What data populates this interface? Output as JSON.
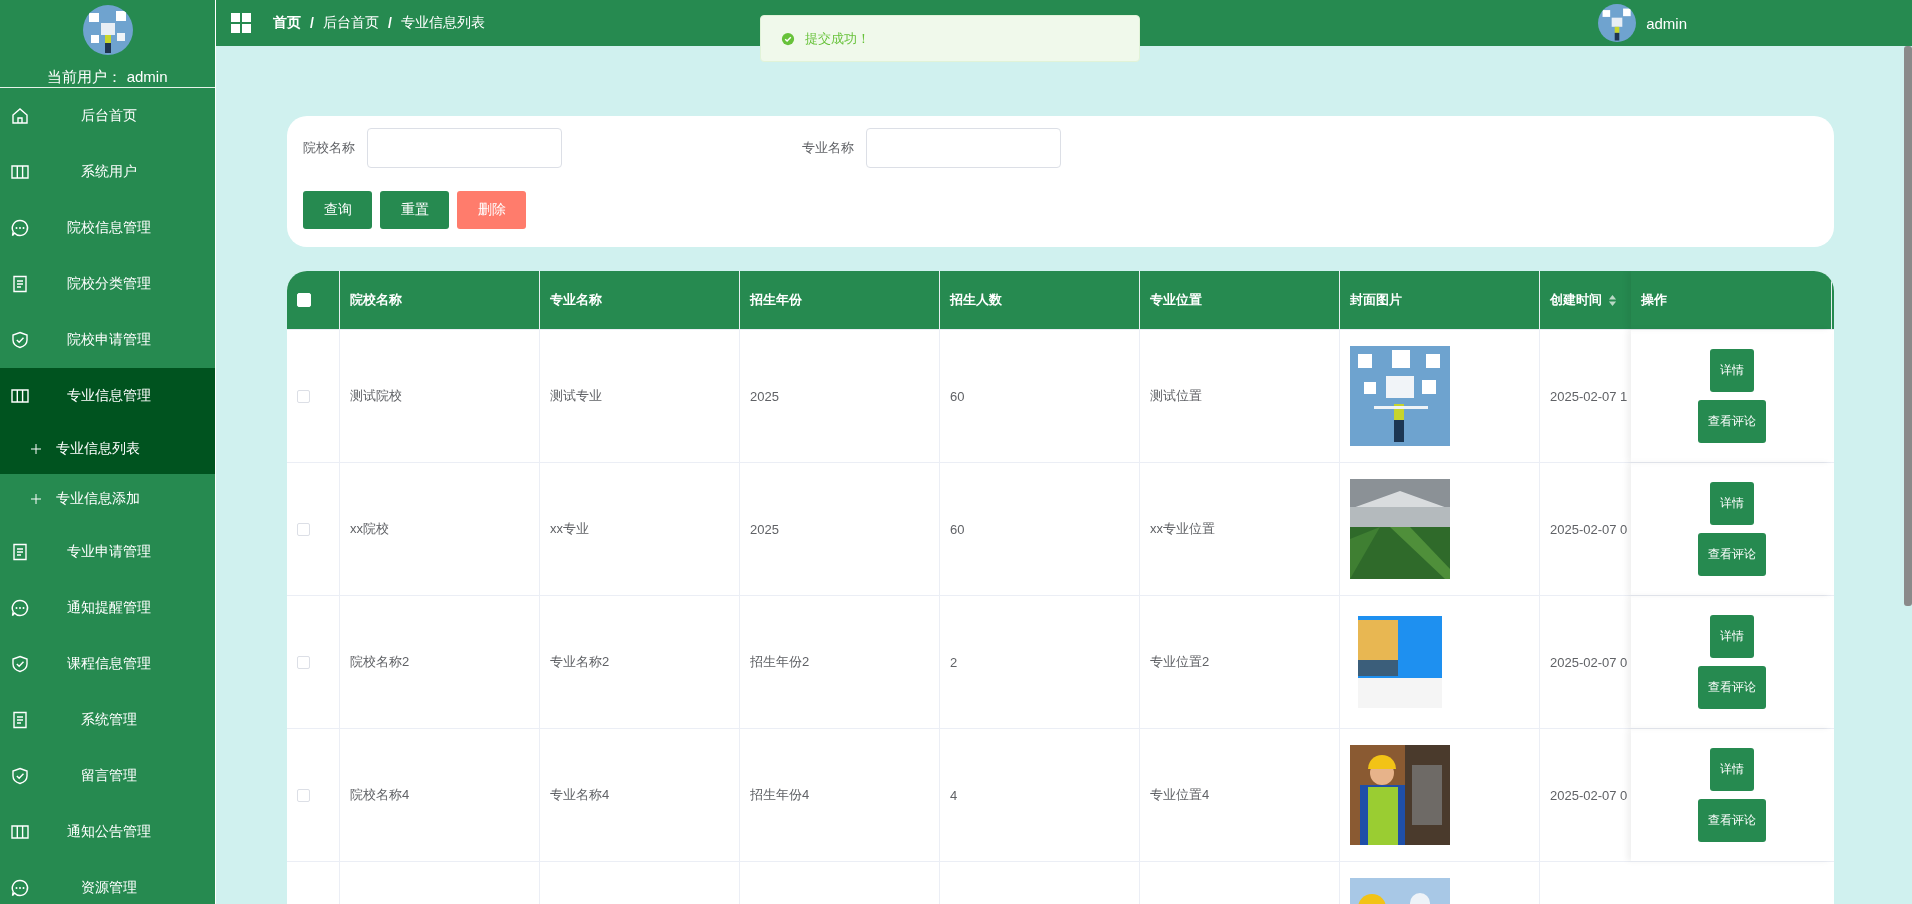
{
  "sidebar": {
    "user": "当前用户： admin",
    "items": [
      {
        "label": "后台首页",
        "selected": false
      },
      {
        "label": "系统用户",
        "selected": false
      },
      {
        "label": "院校信息管理",
        "selected": false
      },
      {
        "label": "院校分类管理",
        "selected": false
      },
      {
        "label": "院校申请管理",
        "selected": false
      },
      {
        "label": "专业信息管理",
        "selected": true,
        "children": [
          {
            "label": "专业信息列表",
            "selected": true
          },
          {
            "label": "专业信息添加",
            "selected": false
          }
        ]
      },
      {
        "label": "专业申请管理",
        "selected": false
      },
      {
        "label": "通知提醒管理",
        "selected": false
      },
      {
        "label": "课程信息管理",
        "selected": false
      },
      {
        "label": "系统管理",
        "selected": false
      },
      {
        "label": "留言管理",
        "selected": false
      },
      {
        "label": "通知公告管理",
        "selected": false
      },
      {
        "label": "资源管理",
        "selected": false
      }
    ]
  },
  "topbar": {
    "breadcrumb": [
      "首页",
      "后台首页",
      "专业信息列表"
    ],
    "separator": "/",
    "user": "admin"
  },
  "toast": {
    "kind": "success",
    "message": "提交成功！"
  },
  "search": {
    "fields": [
      {
        "label": "院校名称"
      },
      {
        "label": "专业名称"
      }
    ],
    "buttons": [
      {
        "label": "查询",
        "kind": "primary"
      },
      {
        "label": "重置",
        "kind": "primary"
      },
      {
        "label": "删除",
        "kind": "danger"
      }
    ]
  },
  "table": {
    "select_all_checked": false,
    "columns": [
      {
        "label": "院校名称",
        "sortable": false
      },
      {
        "label": "专业名称",
        "sortable": false
      },
      {
        "label": "招生年份",
        "sortable": false
      },
      {
        "label": "招生人数",
        "sortable": false
      },
      {
        "label": "专业位置",
        "sortable": false
      },
      {
        "label": "封面图片",
        "sortable": false
      },
      {
        "label": "创建时间",
        "sortable": true
      },
      {
        "label": "操作",
        "sortable": false
      }
    ],
    "rows": [
      {
        "kind": "full",
        "checked": false,
        "cells": [
          "测试院校",
          "测试专业",
          "2025",
          "60",
          "测试位置"
        ],
        "created": "2025-02-07 1",
        "actions": [
          "详情",
          "查看评论"
        ]
      },
      {
        "kind": "full",
        "checked": false,
        "cells": [
          "xx院校",
          "xx专业",
          "2025",
          "60",
          "xx专业位置"
        ],
        "created": "2025-02-07 0",
        "actions": [
          "详情",
          "查看评论"
        ]
      },
      {
        "kind": "full",
        "checked": false,
        "cells": [
          "院校名称2",
          "专业名称2",
          "招生年份2",
          "2",
          "专业位置2"
        ],
        "created": "2025-02-07 0",
        "actions": [
          "详情",
          "查看评论"
        ]
      },
      {
        "kind": "full",
        "checked": false,
        "cells": [
          "院校名称4",
          "专业名称4",
          "招生年份4",
          "4",
          "专业位置4"
        ],
        "created": "2025-02-07 0",
        "actions": [
          "详情",
          "查看评论"
        ]
      },
      {
        "kind": "partial"
      }
    ]
  }
}
